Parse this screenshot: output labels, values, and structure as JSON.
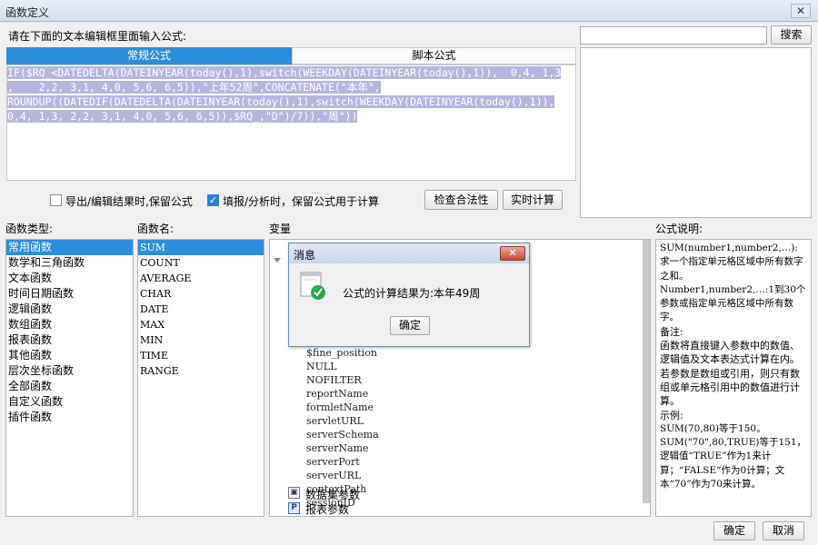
{
  "window": {
    "title": "函数定义",
    "close_glyph": "✕"
  },
  "search": {
    "value": "",
    "button_label": "搜索"
  },
  "editor": {
    "prompt": "请在下面的文本编辑框里面输入公式:",
    "tabs": [
      "常规公式",
      "脚本公式"
    ],
    "lines": [
      "IF($RQ_<DATEDELTA(DATEINYEAR(today(),1),switch(WEEKDAY(DATEINYEAR(today(),1)),  0,4, 1,3",
      ",    2,2, 3,1, 4,0, 5,6, 6,5)),\"上年52周\",CONCATENATE(\"本年\",",
      "ROUNDUP((DATEDIF(DATEDELTA(DATEINYEAR(today(),1),switch(WEEKDAY(DATEINYEAR(today(),1)),",
      "0,4, 1,3, 2,2, 3,1, 4,0, 5,6, 6,5)),$RQ_,\"D\")/7)),\"周\"))"
    ]
  },
  "options": {
    "keep_on_export": {
      "label": "导出/编辑结果时,保留公式",
      "checked": false
    },
    "keep_on_fill": {
      "label": "填报/分析时，保留公式用于计算",
      "checked": true
    },
    "check_label": "检查合法性",
    "realtime_label": "实时计算"
  },
  "function_types": {
    "header": "函数类型:",
    "items": [
      "常用函数",
      "数学和三角函数",
      "文本函数",
      "时间日期函数",
      "逻辑函数",
      "数组函数",
      "报表函数",
      "其他函数",
      "层次坐标函数",
      "全部函数",
      "自定义函数",
      "插件函数"
    ],
    "selected": 0
  },
  "function_names": {
    "header": "函数名:",
    "items": [
      "SUM",
      "COUNT",
      "AVERAGE",
      "CHAR",
      "DATE",
      "MAX",
      "MIN",
      "TIME",
      "RANGE"
    ],
    "selected": 0
  },
  "variables": {
    "header": "变量",
    "items": [
      "$fine_position",
      "NULL",
      "NOFILTER",
      "reportName",
      "formletName",
      "servletURL",
      "serverSchema",
      "serverName",
      "serverPort",
      "serverURL",
      "contextPath",
      "sessionID"
    ],
    "dataset_params": "数据集参数",
    "report_params": "报表参数",
    "report_params_icon": "P"
  },
  "description": {
    "header": "公式说明:",
    "paragraphs": [
      "SUM(number1,number2,…):求一个指定单元格区域中所有数字之和。",
      "Number1,number2,…:1到30个参数或指定单元格区域中所有数字。",
      "备注:",
      "函数将直接键入参数中的数值、逻辑值及文本表达式计算在内。若参数是数组或引用，则只有数组或单元格引用中的数值进行计算。",
      "示例:",
      "SUM(70,80)等于150。",
      "SUM(\"70\",80,TRUE)等于151，逻辑值“TRUE”作为1来计算；“FALSE”作为0计算；文本“70”作为70来计算。"
    ]
  },
  "footer": {
    "ok_label": "确定",
    "cancel_label": "取消"
  },
  "message_dialog": {
    "title": "消息",
    "close_glyph": "✕",
    "text": "公式的计算结果为:本年49周",
    "ok_label": "确定"
  }
}
